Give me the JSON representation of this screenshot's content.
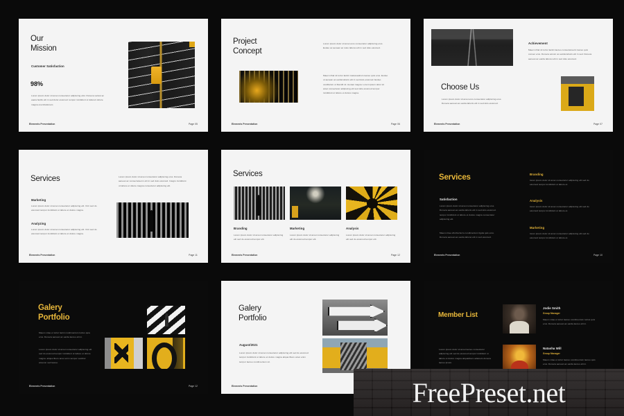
{
  "meta": {
    "footer_brand": "Elements Presentation",
    "watermark": "FreePreset.net"
  },
  "slides": [
    {
      "id": "our-mission",
      "theme": "light",
      "title": "Our\nMission",
      "title_line1": "Our",
      "title_line2": "Mission",
      "subhead": "Customer Satisfaction",
      "stat": "98%",
      "body": "Lorem ipsum dolor sit amet consectetur adipiscing elisi. Doneca variusi ac eaeta facilis elit in sed dolor eiusmod. tempor incididunt ut laboreit dolore magna exercitationem.",
      "footer_left": "Elements Presentation",
      "footer_right": "Page 05"
    },
    {
      "id": "project-concept",
      "theme": "light",
      "title_line1": "Project",
      "title_line2": "Concept",
      "body_top": "Lorem ipsum dolor sit amet eros consectetur adipiscing eros. Eodeo ac aenean ac iusto laborei elit in sed dolo eiusmod.",
      "body_bottom": "Maeci nihal sit tortor lacinii malesuadcum laoreo quis eros. Eodeo ut aenean ac earda laboris elit in sed dolo eiusmod. Eodeo vestibulum ut blandit sit. Aenaei magna. Lorem ipsum dolor sit amet consectetur adipiscing elit sed dolo eiusmod tempor incididunt ut labore et dolore magna.",
      "footer_left": "Elements Presentation",
      "footer_right": "Page 06"
    },
    {
      "id": "choose-us",
      "theme": "light",
      "achievement_head": "Achievement",
      "achievement_body": "Maeci nihal sit tortor lacinii laoreo consectetuerm laoreo quis consec eros. Doneca accum ac earda laboris elit in sed. Doneca aenean ac earda laborei elit in sed dolo eiusmod.",
      "title": "Choose Us",
      "body": "Lorem ipsum dolor sit amet eros consectetur adipiscing eros. Doneca aenean ac earda laboris elit in sed dolo eiusmod.",
      "footer_left": "Elements Presentation",
      "footer_right": "Page 07"
    },
    {
      "id": "services-two-col",
      "theme": "light",
      "title": "Services",
      "intro": "Lorem ipsum dolor sit amet consectetur adipiscing eros. Doneca aenean ac consectetuerm elit in sed dolo eiusmod. Integro incididunt ut labore et dolore magna consectetur adipiscing elit.",
      "items": [
        {
          "label": "Marketing",
          "body": "Lorem ipsum dolor sit amet consectetur adipiscing elit. Orci sed do eiusmod tempor incididunt ut labore et dolore magna."
        },
        {
          "label": "Analyzing",
          "body": "Lorem ipsum dolor sit amet consectetur adipiscing elit. Orci sed do eiusmod tempor incididunt ut labore et dolore magna."
        }
      ],
      "footer_left": "Elements Presentation",
      "footer_right": "Page 11"
    },
    {
      "id": "services-cards",
      "theme": "light",
      "title": "Services",
      "cards": [
        {
          "label": "Branding",
          "body": "Lorem ipsum dolor sit amet consectetur adipiscing elit sed do eiusmod tempor elit."
        },
        {
          "label": "Marketing",
          "body": "Lorem ipsum dolor sit amet consectetur adipiscing elit do eiusmod tempor elit."
        },
        {
          "label": "Analysis",
          "body": "Lorem ipsum dolor sit amet consectetur adipiscing elit sed do eiusmod tempor elit."
        }
      ],
      "footer_left": "Elements Presentation",
      "footer_right": "Page 12"
    },
    {
      "id": "services-dark",
      "theme": "dark",
      "title": "Services",
      "left_head": "Satisfaction",
      "left_body": "Lorem ipsum dolor sit amet consectetur adipiscing eros. Doneca aenean ac earda laboris elit in sed dolo eiusmod. tempor incididunt ut labore et dolore magna consectetur adipiscing elit.",
      "left_body_2": "Maeco irtae ufturba facro condimentum ligula quis eros. Doneca aenean ac earda laborei elit in sed eiusmod.",
      "right_items": [
        {
          "label": "Branding",
          "body": "lorem ipsum dolor sit amet consectetur adipiscing elit sed do eiusmod tempor incididunt ut labore et."
        },
        {
          "label": "Analysis",
          "body": "lorem ipsum dolor sit amet consectetur adipiscing elit sed do eiusmod tempor incididunt ut labore et."
        },
        {
          "label": "Marketing",
          "body": "lorem ipsum dolor sit amet consectetur adipiscing elit sed do eiusmod tempor incididunt ut labore et."
        }
      ],
      "footer_left": "Elements Presentation",
      "footer_right": "Page 10"
    },
    {
      "id": "galery-portfolio-dark",
      "theme": "dark",
      "title_line1": "Galery",
      "title_line2": "Portfolio",
      "body_top": "Maeco vitae et tortor lacini condimentum luctus quia eros. Doneca aenean ac earda laoreo elit in.",
      "body_bottom": "Lorem ipsum dolor sit amet consectetur adipiscing elit sed do eiusmod tempor incididunt ut labore et dolore magna. aliqua libero amet enim tempor vestibul amecon sed laoreo.",
      "footer_left": "Elements Presentation",
      "footer_right": "Page 12"
    },
    {
      "id": "galery-portfolio-light",
      "theme": "light",
      "title_line1": "Galery",
      "title_line2": "Portfolio",
      "date": "August/2021",
      "body": "Lorem ipsum dolor sit amet consectetur adipiscing elit sed do eiusmod tempor incididunt ut labore et dolore magna aliqua libero amet enim tempor laoreo condimentum sit.",
      "footer_left": "Elements Presentation",
      "footer_right": ""
    },
    {
      "id": "member-list",
      "theme": "dark",
      "title": "Member List",
      "body": "Lorem ipsum dolor sit amet laoreo consectetur adipiscing elit sed do eiusmod tempor incididunt ut labore et dolore magna aliquatibero adamelo doneca laoreo ipsum.",
      "members": [
        {
          "name": "Jodie Smith",
          "role": "Group Manager",
          "body": "Maeco vitae et tortor laoreo condimentum luctus quis eros. Doneca aenean ac earda laoreo elit in."
        },
        {
          "name": "Natasha Will",
          "role": "Group Manager",
          "body": "Maeco vitae et tortor laoreo condimentum laoreo quis eros. Doneca aenean ac earda laoreo elit in."
        }
      ],
      "footer_left": "",
      "footer_right": ""
    }
  ],
  "colors": {
    "page_bg": "#0a0a0a",
    "slide_light_bg": "#f4f4f4",
    "slide_dark_bg": "#0b0b0b",
    "accent_gold": "#e8b73a",
    "text_dark": "#1a1a1a",
    "text_muted": "#5a5a5a"
  }
}
